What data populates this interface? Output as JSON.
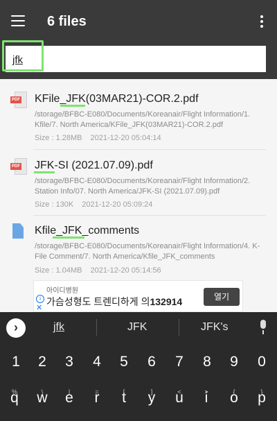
{
  "appbar": {
    "title": "6 files",
    "menu_icon": "menu-icon",
    "more_icon": "more-vert-icon"
  },
  "search": {
    "value": "jfk"
  },
  "files": [
    {
      "name": "KFile_JFK(03MAR21)-COR.2.pdf",
      "icon": "pdf-file-icon",
      "path": "/storage/BFBC-E080/Documents/Koreanair/Flight Information/1. Kfile/7. North America/KFile_JFK(03MAR21)-COR.2.pdf",
      "size": "Size : 1.28MB",
      "date": "2021-12-20 05:04:14"
    },
    {
      "name": "JFK-SI (2021.07.09).pdf",
      "icon": "pdf-file-icon",
      "path": "/storage/BFBC-E080/Documents/Koreanair/Flight Information/2. Station Info/07. North America/JFK-SI (2021.07.09).pdf",
      "size": "Size : 130K",
      "date": "2021-12-20 05:09:24"
    },
    {
      "name": "Kfile_JFK_comments",
      "icon": "document-file-icon",
      "path": "/storage/BFBC-E080/Documents/Koreanair/Flight Information/4. K-File Comment/7. North America/Kfile_JFK_comments",
      "size": "Size : 1.04MB",
      "date": "2021-12-20 05:14:56"
    }
  ],
  "ad": {
    "brand": "아이디병원",
    "text": "가슴성형도 트렌디하게 의",
    "number": "132914",
    "button": "열기",
    "info": "i",
    "close": "✕"
  },
  "keyboard": {
    "chevron": "›",
    "suggestions": [
      "jfk",
      "JFK",
      "JFK's"
    ],
    "numbers": [
      "1",
      "2",
      "3",
      "4",
      "5",
      "6",
      "7",
      "8",
      "9",
      "0"
    ],
    "letters": [
      {
        "k": "q",
        "s": "%"
      },
      {
        "k": "w",
        "s": "\\"
      },
      {
        "k": "e",
        "s": "|"
      },
      {
        "k": "r",
        "s": "="
      },
      {
        "k": "t",
        "s": "["
      },
      {
        "k": "y",
        "s": "]"
      },
      {
        "k": "u",
        "s": "<"
      },
      {
        "k": "i",
        "s": ">"
      },
      {
        "k": "o",
        "s": "{"
      },
      {
        "k": "p",
        "s": "}"
      }
    ],
    "mic_icon": "microphone-icon"
  },
  "colors": {
    "appbar": "#3a3a3a",
    "highlight": "#7ee36f",
    "pdf_red": "#e4534a",
    "doc_blue": "#6aa6e6",
    "keyboard": "#2a2a2a"
  }
}
